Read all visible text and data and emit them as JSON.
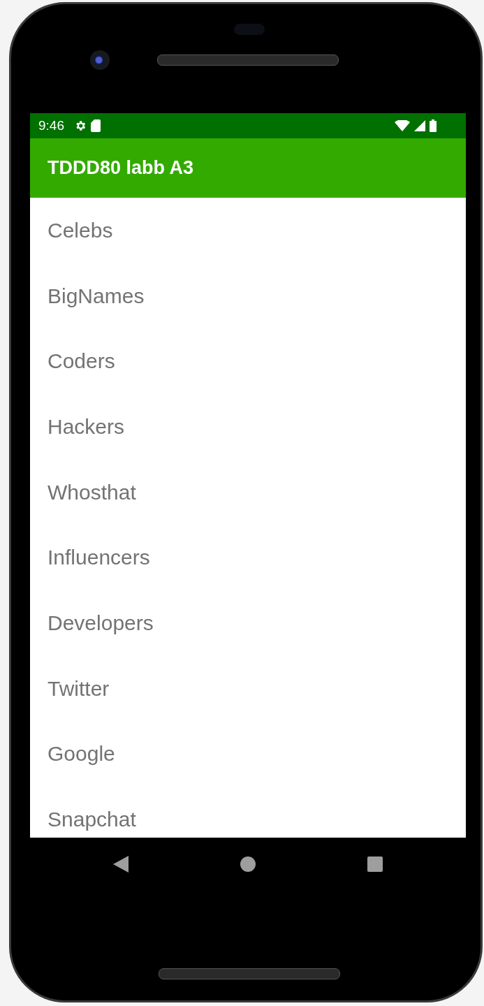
{
  "status_bar": {
    "time": "9:46"
  },
  "app_bar": {
    "title": "TDDD80 labb A3"
  },
  "list": {
    "items": [
      {
        "label": "Celebs"
      },
      {
        "label": "BigNames"
      },
      {
        "label": "Coders"
      },
      {
        "label": "Hackers"
      },
      {
        "label": "Whosthat"
      },
      {
        "label": "Influencers"
      },
      {
        "label": "Developers"
      },
      {
        "label": "Twitter"
      },
      {
        "label": "Google"
      },
      {
        "label": "Snapchat"
      }
    ]
  }
}
